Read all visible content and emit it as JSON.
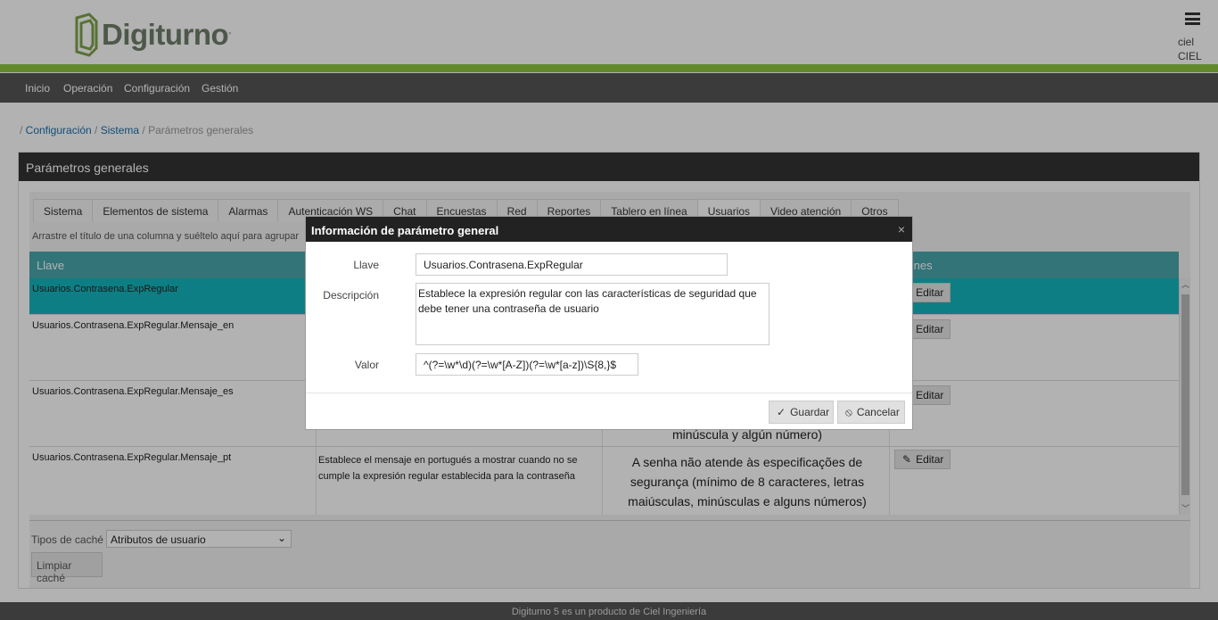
{
  "header": {
    "logo_text": "Digiturno",
    "user_line1": "ciel",
    "user_line2": "CIEL"
  },
  "nav": {
    "items": [
      "Inicio",
      "Operación",
      "Configuración",
      "Gestión"
    ]
  },
  "breadcrumb": {
    "sep1": "/ ",
    "link1": "Configuración",
    "sep2": " / ",
    "link2": "Sistema",
    "current": " / Parámetros generales"
  },
  "panel": {
    "title": "Parámetros generales",
    "tabs": [
      "Sistema",
      "Elementos de sistema",
      "Alarmas",
      "Autenticación WS",
      "Chat",
      "Encuestas",
      "Red",
      "Reportes",
      "Tablero en línea",
      "Usuarios",
      "Video atención",
      "Otros"
    ],
    "active_tab": "Usuarios",
    "group_hint": "Arrastre el título de una columna y suéltelo aquí para agrupar",
    "columns": {
      "key": "Llave",
      "actions": "ciones"
    },
    "rows": [
      {
        "key": "Usuarios.Contrasena.ExpRegular",
        "desc": "",
        "value": "",
        "edit": "Editar"
      },
      {
        "key": "Usuarios.Contrasena.ExpRegular.Mensaje_en",
        "desc": "",
        "value": "",
        "edit": "Editar"
      },
      {
        "key": "Usuarios.Contrasena.ExpRegular.Mensaje_es",
        "desc": "",
        "value": "minúscula y algún número)",
        "edit": "Editar"
      },
      {
        "key": "Usuarios.Contrasena.ExpRegular.Mensaje_pt",
        "desc": "Establece el mensaje en portugués a mostrar cuando no se cumple la expresión regular establecida para la contraseña",
        "value": "A senha não atende às especificações de segurança (mínimo de 8 caracteres, letras maiúsculas, minúsculas e alguns números)",
        "edit": "Editar"
      }
    ],
    "cache_label": "Tipos de caché",
    "cache_value": "Atributos de usuario",
    "clear_cache": "Limpiar caché"
  },
  "footer": {
    "text": "Digiturno 5 es un producto de Ciel Ingeniería"
  },
  "modal": {
    "title": "Información de parámetro general",
    "close": "×",
    "key_label": "Llave",
    "key_value": "Usuarios.Contrasena.ExpRegular",
    "desc_label": "Descripción",
    "desc_value": "Establece la expresión regular con las características de seguridad que debe tener una contraseña de usuario",
    "value_label": "Valor",
    "value_value": "^(?=\\w*\\d)(?=\\w*[A-Z])(?=\\w*[a-z])\\S{8,}$",
    "save": "Guardar",
    "cancel": "Cancelar"
  },
  "colors": {
    "green_bar": "#8dc63f",
    "nav_bg": "#555555",
    "grid_header": "#4aa7ad",
    "selected_row": "#14b6bd"
  }
}
